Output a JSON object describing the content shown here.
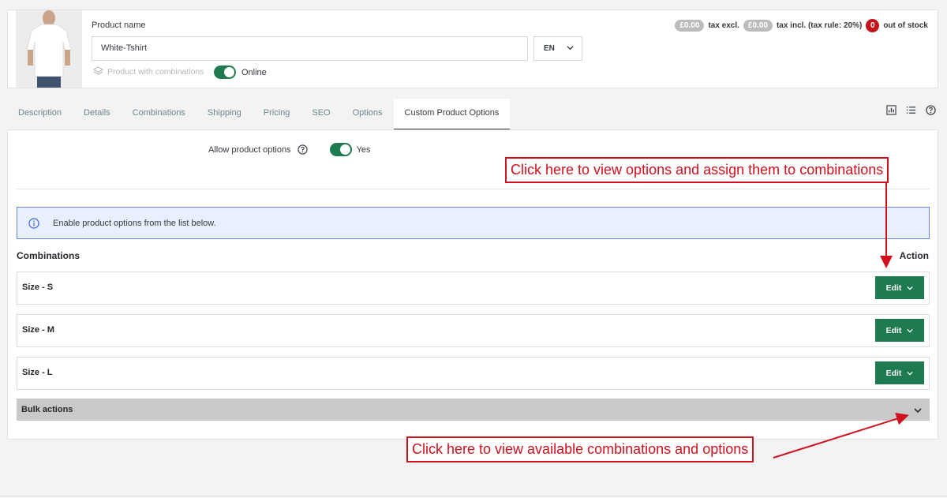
{
  "header": {
    "product_name_label": "Product name",
    "product_name_value": "White-Tshirt",
    "language": "EN",
    "combinations_flag": "Product with combinations",
    "online_label": "Online",
    "price_excl": "£0.00",
    "price_excl_label": "tax excl.",
    "price_incl": "£0.00",
    "price_incl_label": "tax incl. (tax rule: 20%)",
    "stock_count": "0",
    "stock_label": "out of stock"
  },
  "tabs": [
    {
      "label": "Description"
    },
    {
      "label": "Details"
    },
    {
      "label": "Combinations"
    },
    {
      "label": "Shipping"
    },
    {
      "label": "Pricing"
    },
    {
      "label": "SEO"
    },
    {
      "label": "Options"
    },
    {
      "label": "Custom Product Options",
      "active": true
    }
  ],
  "panel": {
    "allow_label": "Allow product options",
    "allow_value": "Yes",
    "info_text": "Enable product options from the list below.",
    "combinations_heading": "Combinations",
    "action_heading": "Action",
    "rows": [
      {
        "name": "Size - S",
        "button": "Edit"
      },
      {
        "name": "Size - M",
        "button": "Edit"
      },
      {
        "name": "Size - L",
        "button": "Edit"
      }
    ],
    "bulk_label": "Bulk actions"
  },
  "annotations": {
    "top": "Click here to view options and assign them to combinations",
    "bottom": "Click here to view available combinations and options"
  },
  "colors": {
    "primary_green": "#1e7a4f",
    "annotation_red": "#d0101d",
    "info_border": "#6b86d6",
    "stock_red": "#c3141a"
  }
}
